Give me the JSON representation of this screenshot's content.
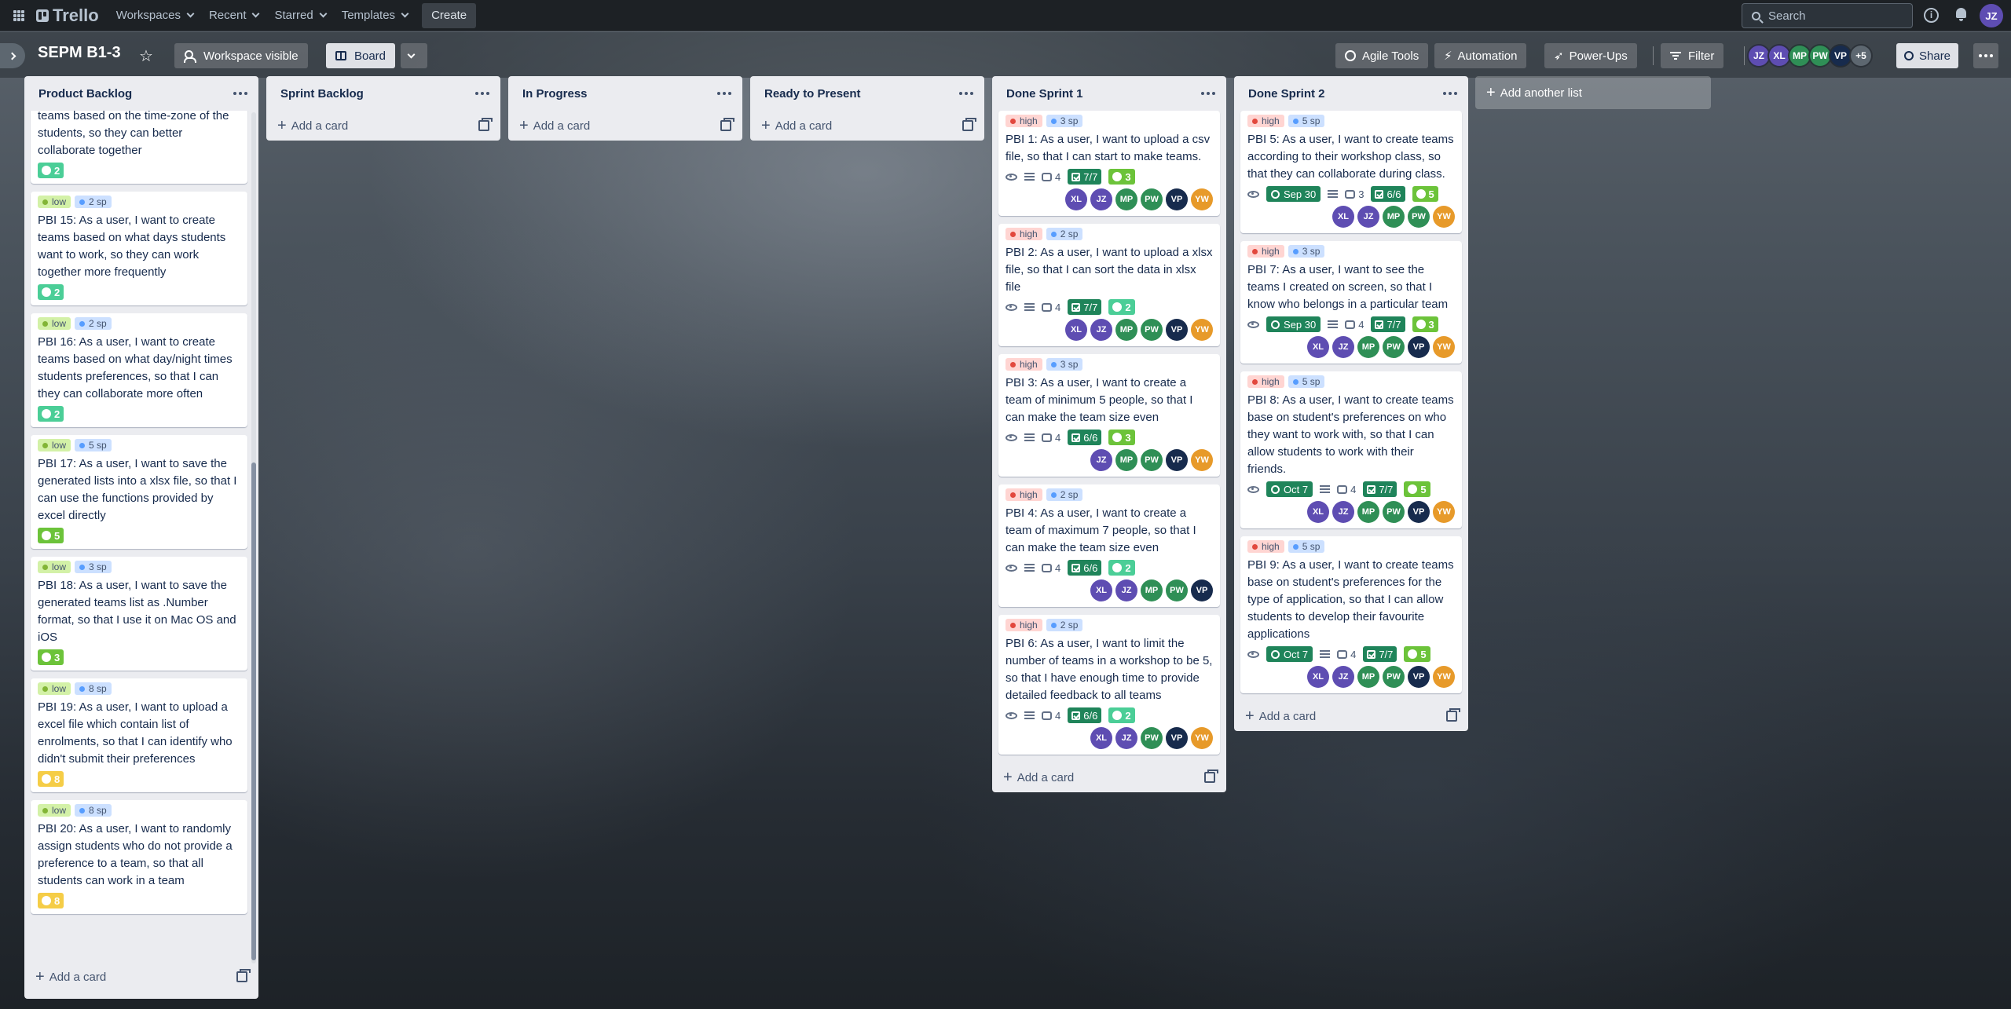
{
  "topnav": {
    "brand": "Trello",
    "workspaces": "Workspaces",
    "recent": "Recent",
    "starred": "Starred",
    "templates": "Templates",
    "create": "Create",
    "search_placeholder": "Search",
    "user_initials": "JZ"
  },
  "boardbar": {
    "name": "SEPM B1-3",
    "visibility": "Workspace visible",
    "view": "Board",
    "agile_tools": "Agile Tools",
    "automation": "Automation",
    "power_ups": "Power-Ups",
    "filter": "Filter",
    "share": "Share",
    "members": [
      {
        "i": "JZ",
        "c": "#5e4db2"
      },
      {
        "i": "XL",
        "c": "#5e4db2"
      },
      {
        "i": "MP",
        "c": "#2f8f56"
      },
      {
        "i": "PW",
        "c": "#2f8f56"
      },
      {
        "i": "VP",
        "c": "#172b4d"
      }
    ],
    "more_members": "+5"
  },
  "add_another_list": "Add another list",
  "add_card": "Add a card",
  "lists": [
    {
      "title": "Product Backlog",
      "cards": [
        {
          "partial": true,
          "labels": [],
          "title": "teams based on the time-zone of the students, so they can better collaborate together",
          "points": "2",
          "pcolor": "g1",
          "avatars": []
        },
        {
          "labels": [
            [
              "low",
              "low"
            ],
            [
              "sp",
              "2 sp"
            ]
          ],
          "title": "PBI 15: As a user, I want to create teams based on what days students want to work, so they can work together more frequently",
          "points": "2",
          "pcolor": "g1",
          "avatars": []
        },
        {
          "labels": [
            [
              "low",
              "low"
            ],
            [
              "sp",
              "2 sp"
            ]
          ],
          "title": "PBI 16: As a user, I want to create teams based on what day/night times students preferences, so that I can they can collaborate more often",
          "points": "2",
          "pcolor": "g1",
          "avatars": []
        },
        {
          "labels": [
            [
              "low",
              "low"
            ],
            [
              "sp",
              "5 sp"
            ]
          ],
          "title": "PBI 17: As a user, I want to save the generated lists into a xlsx file, so that I can use the functions provided by excel directly",
          "points": "5",
          "pcolor": "g2",
          "avatars": []
        },
        {
          "labels": [
            [
              "low",
              "low"
            ],
            [
              "sp",
              "3 sp"
            ]
          ],
          "title": "PBI 18: As a user, I want to save the generated teams list as .Number format, so that I use it on Mac OS and iOS",
          "points": "3",
          "pcolor": "g2",
          "avatars": []
        },
        {
          "labels": [
            [
              "low",
              "low"
            ],
            [
              "sp",
              "8 sp"
            ]
          ],
          "title": "PBI 19: As a user, I want to upload a excel file which contain list of enrolments, so that I can identify who didn't submit their preferences",
          "points": "8",
          "pcolor": "y",
          "avatars": []
        },
        {
          "labels": [
            [
              "low",
              "low"
            ],
            [
              "sp",
              "8 sp"
            ]
          ],
          "title": "PBI 20: As a user, I want to randomly assign students who do not provide a preference to a team, so that all students can work in a team",
          "points": "8",
          "pcolor": "y",
          "avatars": []
        }
      ]
    },
    {
      "title": "Sprint Backlog",
      "cards": []
    },
    {
      "title": "In Progress",
      "cards": []
    },
    {
      "title": "Ready to Present",
      "cards": []
    },
    {
      "title": "Done Sprint 1",
      "cards": [
        {
          "labels": [
            [
              "high",
              "high"
            ],
            [
              "sp",
              "3 sp"
            ]
          ],
          "title": "PBI 1: As a user, I want to upload a csv file, so that I can start to make teams.",
          "comments": "4",
          "checklist": "7/7",
          "points": "3",
          "pcolor": "g2",
          "avatars": [
            "XL",
            "JZ",
            "MP",
            "PW",
            "VP",
            "YW"
          ]
        },
        {
          "labels": [
            [
              "high",
              "high"
            ],
            [
              "sp",
              "2 sp"
            ]
          ],
          "title": "PBI 2: As a user, I want to upload a xlsx file, so that I can sort the data in xlsx file",
          "comments": "4",
          "checklist": "7/7",
          "points": "2",
          "pcolor": "g1",
          "avatars": [
            "XL",
            "JZ",
            "MP",
            "PW",
            "VP",
            "YW"
          ]
        },
        {
          "labels": [
            [
              "high",
              "high"
            ],
            [
              "sp",
              "3 sp"
            ]
          ],
          "title": "PBI 3: As a user, I want to create a team of minimum 5 people, so that I can make the team size even",
          "comments": "4",
          "checklist": "6/6",
          "points": "3",
          "pcolor": "g2",
          "avatars": [
            "JZ",
            "MP",
            "PW",
            "VP",
            "YW"
          ]
        },
        {
          "labels": [
            [
              "high",
              "high"
            ],
            [
              "sp",
              "2 sp"
            ]
          ],
          "title": "PBI 4: As a user, I want to create a team of maximum 7 people, so that I can make the team size even",
          "comments": "4",
          "checklist": "6/6",
          "points": "2",
          "pcolor": "g1",
          "avatars": [
            "XL",
            "JZ",
            "MP",
            "PW",
            "VP"
          ]
        },
        {
          "labels": [
            [
              "high",
              "high"
            ],
            [
              "sp",
              "2 sp"
            ]
          ],
          "title": "PBI 6: As a user, I want to limit the number of teams in a workshop to be 5, so that I have enough time to provide detailed feedback to all teams",
          "comments": "4",
          "checklist": "6/6",
          "points": "2",
          "pcolor": "g1",
          "avatars": [
            "XL",
            "JZ",
            "PW",
            "VP",
            "YW"
          ]
        }
      ]
    },
    {
      "title": "Done Sprint 2",
      "cards": [
        {
          "labels": [
            [
              "high",
              "high"
            ],
            [
              "sp",
              "5 sp"
            ]
          ],
          "title": "PBI 5: As a user, I want to create teams according to their workshop class, so that they can collaborate during class.",
          "due": "Sep 30",
          "comments": "3",
          "checklist": "6/6",
          "points": "5",
          "pcolor": "g2",
          "avatars": [
            "XL",
            "JZ",
            "MP",
            "PW",
            "YW"
          ]
        },
        {
          "labels": [
            [
              "high",
              "high"
            ],
            [
              "sp",
              "3 sp"
            ]
          ],
          "title": "PBI 7: As a user, I want to see the teams I created on screen, so that I know who belongs in a particular team",
          "due": "Sep 30",
          "comments": "4",
          "checklist": "7/7",
          "points": "3",
          "pcolor": "g2",
          "avatars": [
            "XL",
            "JZ",
            "MP",
            "PW",
            "VP",
            "YW"
          ]
        },
        {
          "labels": [
            [
              "high",
              "high"
            ],
            [
              "sp",
              "5 sp"
            ]
          ],
          "title": "PBI 8: As a user, I want to create teams base on student's preferences on who they want to work with, so that I can allow students to work with their friends.",
          "due": "Oct 7",
          "comments": "4",
          "checklist": "7/7",
          "points": "5",
          "pcolor": "g2",
          "avatars": [
            "XL",
            "JZ",
            "MP",
            "PW",
            "VP",
            "YW"
          ]
        },
        {
          "labels": [
            [
              "high",
              "high"
            ],
            [
              "sp",
              "5 sp"
            ]
          ],
          "title": "PBI 9: As a user, I want to create teams base on student's preferences for the type of application, so that I can allow students to develop their favourite applications",
          "due": "Oct 7",
          "comments": "4",
          "checklist": "7/7",
          "points": "5",
          "pcolor": "g2",
          "avatars": [
            "XL",
            "JZ",
            "MP",
            "PW",
            "VP",
            "YW"
          ]
        }
      ]
    }
  ]
}
